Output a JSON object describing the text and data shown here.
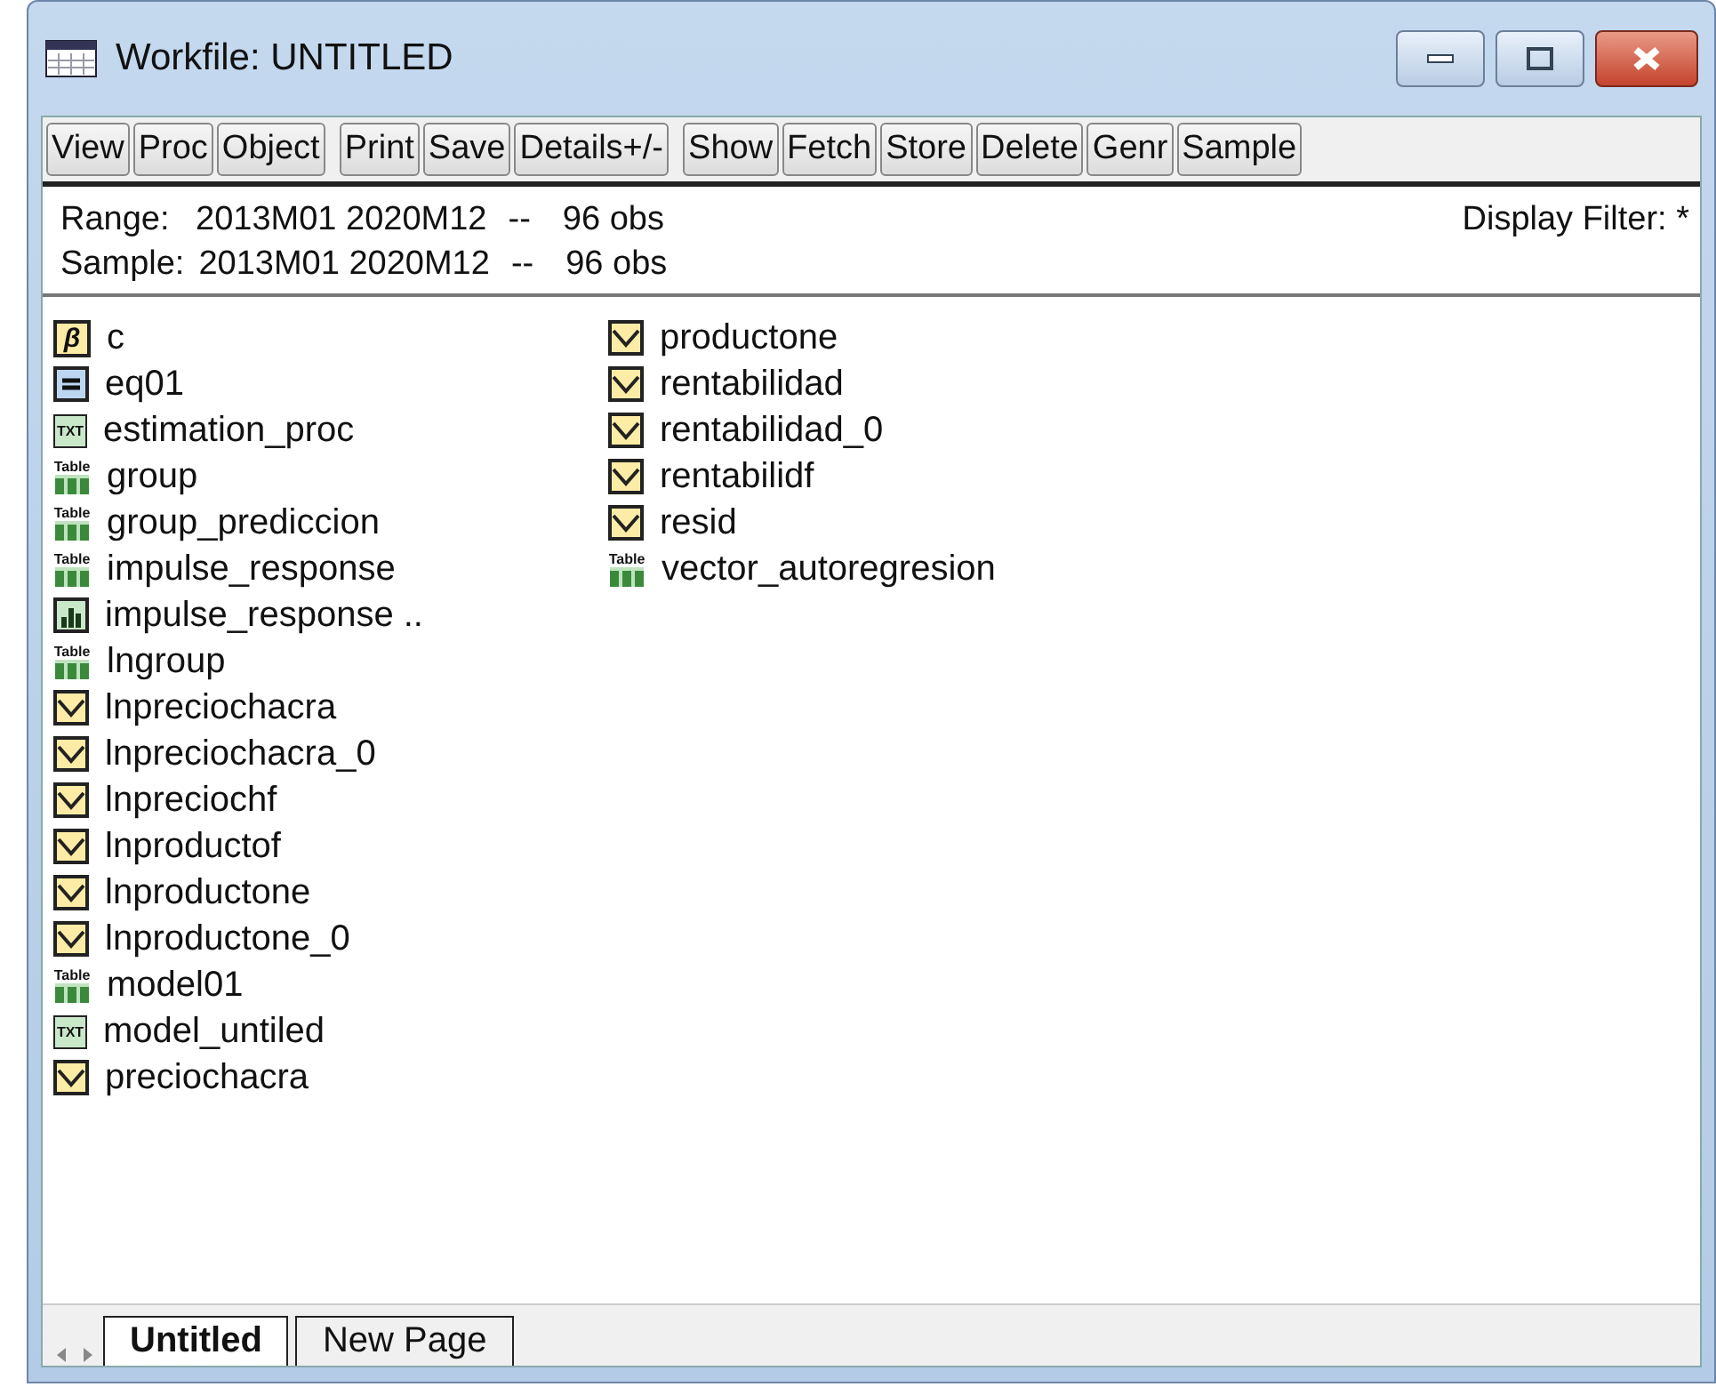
{
  "window": {
    "title": "Workfile: UNTITLED"
  },
  "toolbar_groups": [
    [
      "View",
      "Proc",
      "Object"
    ],
    [
      "Print",
      "Save",
      "Details+/-"
    ],
    [
      "Show",
      "Fetch",
      "Store",
      "Delete",
      "Genr",
      "Sample"
    ]
  ],
  "info": {
    "range_label": "Range:",
    "range": "2013M01 2020M12",
    "range_sep": "--",
    "range_obs": "96 obs",
    "filter": "Display Filter: *",
    "sample_label": "Sample:",
    "sample": "2013M01 2020M12",
    "sample_sep": "--",
    "sample_obs": "96 obs"
  },
  "objects": [
    {
      "name": "c",
      "kind": "coef",
      "glyph": "β"
    },
    {
      "name": "eq01",
      "kind": "equation"
    },
    {
      "name": "estimation_proc",
      "kind": "text",
      "glyph": "TXT"
    },
    {
      "name": "group",
      "kind": "table",
      "glyph": "Table"
    },
    {
      "name": "group_prediccion",
      "kind": "table",
      "glyph": "Table"
    },
    {
      "name": "impulse_response",
      "kind": "table",
      "glyph": "Table"
    },
    {
      "name": "impulse_response ..",
      "kind": "graph"
    },
    {
      "name": "lngroup",
      "kind": "table",
      "glyph": "Table"
    },
    {
      "name": "lnpreciochacra",
      "kind": "series"
    },
    {
      "name": "lnpreciochacra_0",
      "kind": "series"
    },
    {
      "name": "lnpreciochf",
      "kind": "series"
    },
    {
      "name": "lnproductof",
      "kind": "series"
    },
    {
      "name": "lnproductone",
      "kind": "series"
    },
    {
      "name": "lnproductone_0",
      "kind": "series"
    },
    {
      "name": "model01",
      "kind": "table",
      "glyph": "Table"
    },
    {
      "name": "model_untiled",
      "kind": "text",
      "glyph": "TXT"
    },
    {
      "name": "preciochacra",
      "kind": "series"
    },
    {
      "name": "productone",
      "kind": "series"
    },
    {
      "name": "rentabilidad",
      "kind": "series"
    },
    {
      "name": "rentabilidad_0",
      "kind": "series"
    },
    {
      "name": "rentabilidf",
      "kind": "series"
    },
    {
      "name": "resid",
      "kind": "series"
    },
    {
      "name": "vector_autoregresion",
      "kind": "table",
      "glyph": "Table"
    }
  ],
  "tabs": [
    {
      "label": "Untitled",
      "selected": true
    },
    {
      "label": "New Page",
      "selected": false
    }
  ]
}
